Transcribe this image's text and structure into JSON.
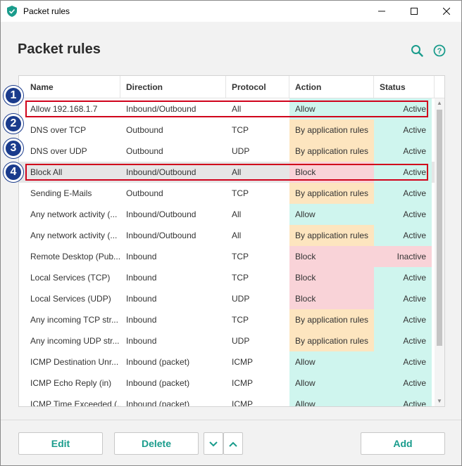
{
  "window": {
    "title": "Packet rules",
    "min_glyph": "—",
    "max_glyph": "☐",
    "close_glyph": "✕"
  },
  "header": {
    "title": "Packet rules"
  },
  "table": {
    "columns": [
      "Name",
      "Direction",
      "Protocol",
      "Action",
      "Status"
    ],
    "rows": [
      {
        "name": "Allow 192.168.1.7",
        "direction": "Inbound/Outbound",
        "protocol": "All",
        "action": "Allow",
        "status": "Active"
      },
      {
        "name": "DNS over TCP",
        "direction": "Outbound",
        "protocol": "TCP",
        "action": "By application rules",
        "status": "Active"
      },
      {
        "name": "DNS over UDP",
        "direction": "Outbound",
        "protocol": "UDP",
        "action": "By application rules",
        "status": "Active"
      },
      {
        "name": "Block All",
        "direction": "Inbound/Outbound",
        "protocol": "All",
        "action": "Block",
        "status": "Active"
      },
      {
        "name": "Sending E-Mails",
        "direction": "Outbound",
        "protocol": "TCP",
        "action": "By application rules",
        "status": "Active"
      },
      {
        "name": "Any network activity (...",
        "direction": "Inbound/Outbound",
        "protocol": "All",
        "action": "Allow",
        "status": "Active"
      },
      {
        "name": "Any network activity (...",
        "direction": "Inbound/Outbound",
        "protocol": "All",
        "action": "By application rules",
        "status": "Active"
      },
      {
        "name": "Remote Desktop (Pub...",
        "direction": "Inbound",
        "protocol": "TCP",
        "action": "Block",
        "status": "Inactive"
      },
      {
        "name": "Local Services (TCP)",
        "direction": "Inbound",
        "protocol": "TCP",
        "action": "Block",
        "status": "Active"
      },
      {
        "name": "Local Services (UDP)",
        "direction": "Inbound",
        "protocol": "UDP",
        "action": "Block",
        "status": "Active"
      },
      {
        "name": "Any incoming TCP str...",
        "direction": "Inbound",
        "protocol": "TCP",
        "action": "By application rules",
        "status": "Active"
      },
      {
        "name": "Any incoming UDP str...",
        "direction": "Inbound",
        "protocol": "UDP",
        "action": "By application rules",
        "status": "Active"
      },
      {
        "name": "ICMP Destination Unr...",
        "direction": "Inbound (packet)",
        "protocol": "ICMP",
        "action": "Allow",
        "status": "Active"
      },
      {
        "name": "ICMP Echo Reply (in)",
        "direction": "Inbound (packet)",
        "protocol": "ICMP",
        "action": "Allow",
        "status": "Active"
      },
      {
        "name": "ICMP Time Exceeded (...",
        "direction": "Inbound (packet)",
        "protocol": "ICMP",
        "action": "Allow",
        "status": "Active"
      }
    ]
  },
  "annotations": [
    "1",
    "2",
    "3",
    "4"
  ],
  "colors": {
    "allow": "#cff5ee",
    "by_app": "#fde5bf",
    "block": "#f9d3d8",
    "active": "#cff5ee",
    "inactive": "#f9d3d8",
    "accent": "#1a9c8c",
    "highlight": "#d0021b",
    "badge": "#1a3b8c"
  },
  "footer": {
    "edit": "Edit",
    "delete": "Delete",
    "add": "Add"
  }
}
